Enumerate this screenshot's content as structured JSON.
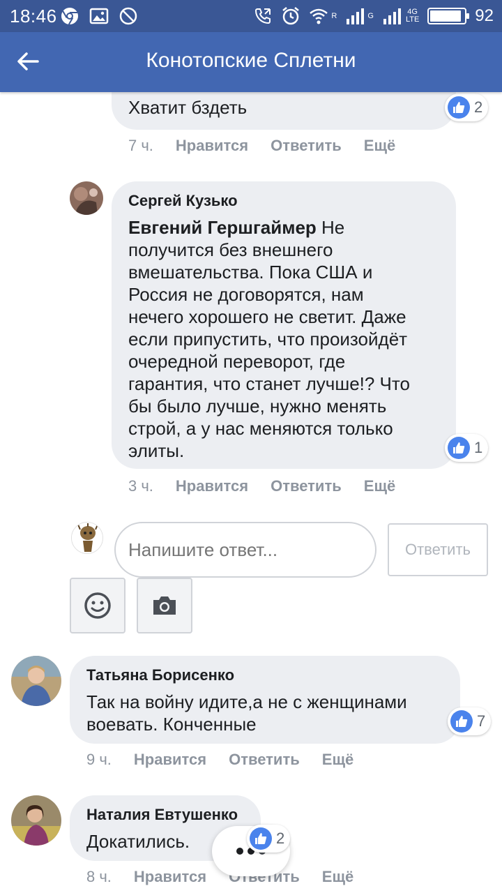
{
  "status_bar": {
    "time": "18:46",
    "battery": "92",
    "battery_level": 0.92,
    "net_left": "R",
    "net_right": "G",
    "lte_label": "4G"
  },
  "app_bar": {
    "title": "Конотопские Сплетни"
  },
  "comments": [
    {
      "text": "Хватит бздеть",
      "likes": "2",
      "time": "7 ч.",
      "like_label": "Нравится",
      "reply_label": "Ответить",
      "more_label": "Ещё"
    },
    {
      "author": "Сергей Кузько",
      "mention": "Евгений Гершгаймер",
      "lines": [
        " Не",
        "получится без внешнего",
        "вмешательства. Пока США и",
        "Россия не договорятся, нам",
        "нечего хорошего не светит. Даже",
        "если припустить, что произойдёт",
        "очередной переворот, где",
        "гарантия, что станет лучше!? Что",
        "бы было лучше, нужно менять",
        "строй, а у нас меняются только",
        "элиты."
      ],
      "likes": "1",
      "time": "3 ч.",
      "like_label": "Нравится",
      "reply_label": "Ответить",
      "more_label": "Ещё"
    },
    {
      "author": "Татьяна Борисенко",
      "lines": [
        "Так на войну идите,а не с женщинами",
        "воевать. Конченные"
      ],
      "likes": "7",
      "time": "9 ч.",
      "like_label": "Нравится",
      "reply_label": "Ответить",
      "more_label": "Ещё"
    },
    {
      "author": "Наталия Евтушенко",
      "lines": [
        "Докатились."
      ],
      "likes": "2",
      "time": "8 ч.",
      "like_label": "Нравится",
      "reply_label": "Ответить",
      "more_label": "Ещё"
    }
  ],
  "reply": {
    "placeholder": "Напишите ответ...",
    "button": "Ответить"
  },
  "colors": {
    "status_bar": "#3a5795",
    "app_bar": "#4267b2",
    "bubble": "#eceef2",
    "like_blue": "#4a83ec",
    "meta_gray": "#8d949e"
  },
  "icons": {
    "back": "arrow-left-icon",
    "like": "thumbs-up-icon",
    "emoji": "smiley-icon",
    "camera": "camera-icon"
  }
}
